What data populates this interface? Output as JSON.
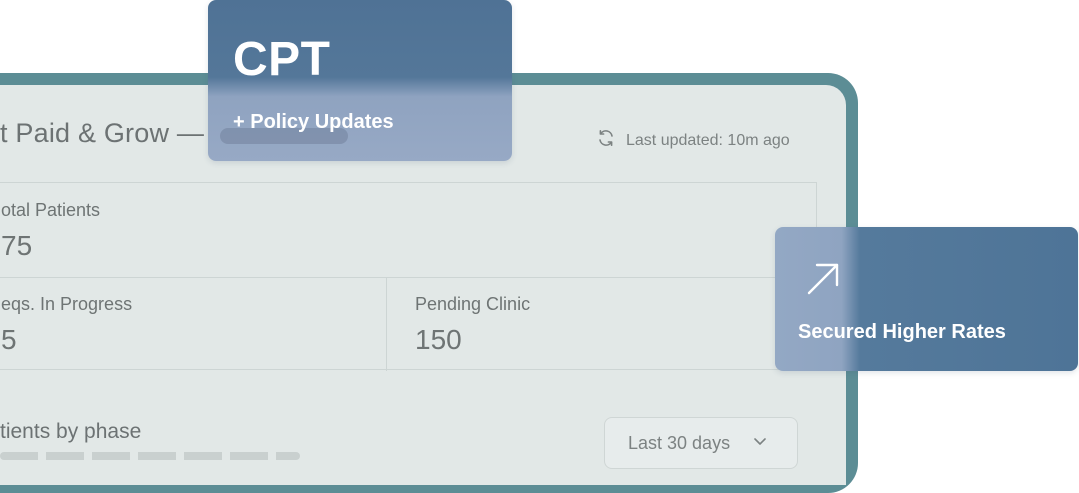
{
  "dashboard": {
    "title": "t Paid & Grow —",
    "last_updated": "Last updated: 10m ago",
    "stats": {
      "total_patients_label": "otal Patients",
      "total_patients_value": "75",
      "reqs_label": "eqs. In Progress",
      "reqs_value": "5",
      "pending_label": "Pending Clinic",
      "pending_value": "150"
    },
    "phase_title": "tients by phase",
    "range_select": "Last 30 days"
  },
  "cards": {
    "cpt_title": "CPT",
    "cpt_sub": "+ Policy Updates",
    "rates_label": "Secured Higher Rates"
  },
  "icons": {
    "refresh": "refresh-icon",
    "chevron": "chevron-down-icon",
    "arrow": "arrow-up-right-icon"
  },
  "colors": {
    "frame": "#5c8d95",
    "panel": "#e2e8e7",
    "card_blue": "#4e7497",
    "card_light": "#93a8c4"
  }
}
